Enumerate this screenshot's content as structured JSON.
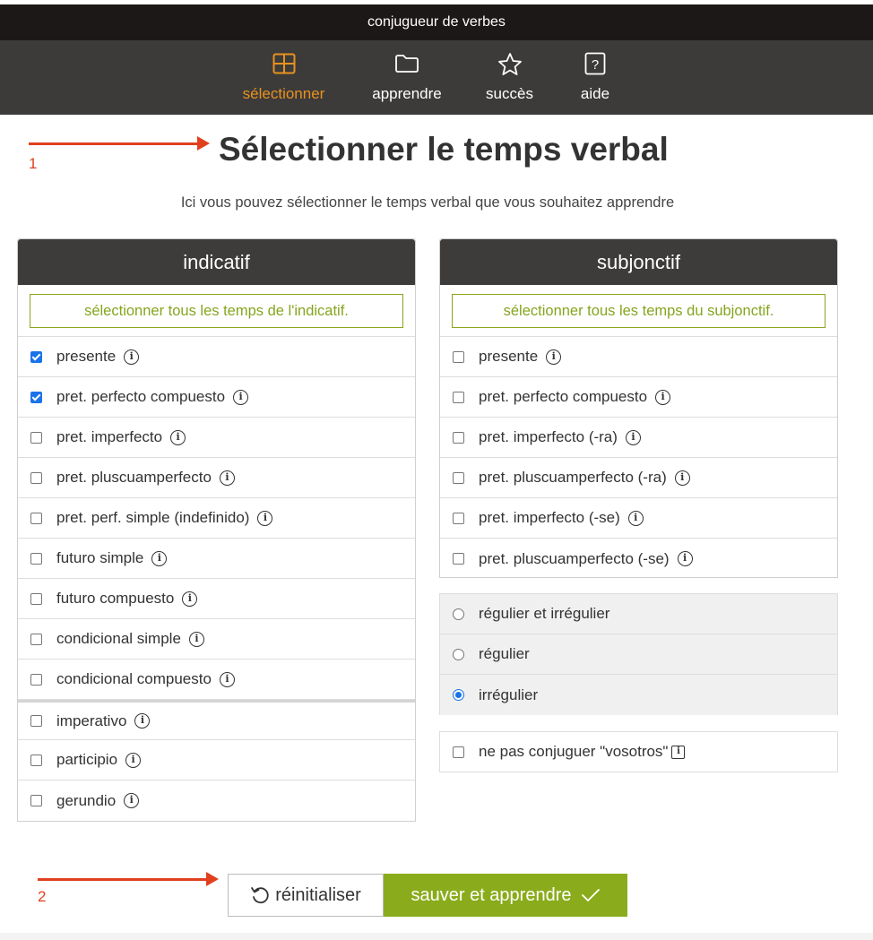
{
  "app": {
    "title": "conjugueur de verbes"
  },
  "nav": {
    "items": [
      {
        "label": "sélectionner",
        "icon": "grid-icon",
        "active": true
      },
      {
        "label": "apprendre",
        "icon": "folder-icon",
        "active": false
      },
      {
        "label": "succès",
        "icon": "star-icon",
        "active": false
      },
      {
        "label": "aide",
        "icon": "help-icon",
        "active": false
      }
    ]
  },
  "annotations": {
    "step1": "1",
    "step2": "2"
  },
  "page": {
    "title": "Sélectionner le temps verbal",
    "subtitle": "Ici vous pouvez sélectionner le temps verbal que vous souhaitez apprendre"
  },
  "indicatif": {
    "header": "indicatif",
    "select_all": "sélectionner tous les temps de l'indicatif.",
    "tenses": [
      {
        "label": "presente",
        "checked": true
      },
      {
        "label": "pret. perfecto compuesto",
        "checked": true
      },
      {
        "label": "pret. imperfecto",
        "checked": false
      },
      {
        "label": "pret. pluscuamperfecto",
        "checked": false
      },
      {
        "label": "pret. perf. simple (indefinido)",
        "checked": false
      },
      {
        "label": "futuro simple",
        "checked": false
      },
      {
        "label": "futuro compuesto",
        "checked": false
      },
      {
        "label": "condicional simple",
        "checked": false
      },
      {
        "label": "condicional compuesto",
        "checked": false
      },
      {
        "label": "imperativo",
        "checked": false
      },
      {
        "label": "participio",
        "checked": false
      },
      {
        "label": "gerundio",
        "checked": false
      }
    ]
  },
  "subjonctif": {
    "header": "subjonctif",
    "select_all": "sélectionner tous les temps du subjonctif.",
    "tenses": [
      {
        "label": "presente",
        "checked": false
      },
      {
        "label": "pret. perfecto compuesto",
        "checked": false
      },
      {
        "label": "pret. imperfecto (-ra)",
        "checked": false
      },
      {
        "label": "pret. pluscuamperfecto (-ra)",
        "checked": false
      },
      {
        "label": "pret. imperfecto (-se)",
        "checked": false
      },
      {
        "label": "pret. pluscuamperfecto (-se)",
        "checked": false
      }
    ]
  },
  "verb_type": {
    "options": [
      {
        "label": "régulier et irrégulier",
        "selected": false
      },
      {
        "label": "régulier",
        "selected": false
      },
      {
        "label": "irrégulier",
        "selected": true
      }
    ]
  },
  "vosotros": {
    "label": "ne pas conjuguer \"vosotros\"",
    "checked": false
  },
  "buttons": {
    "reset": "réinitialiser",
    "save": "sauver et apprendre"
  },
  "colors": {
    "accent_orange": "#e8911f",
    "green": "#8aac1c",
    "arrow_red": "#e0401e",
    "dark": "#3c3b3a"
  }
}
